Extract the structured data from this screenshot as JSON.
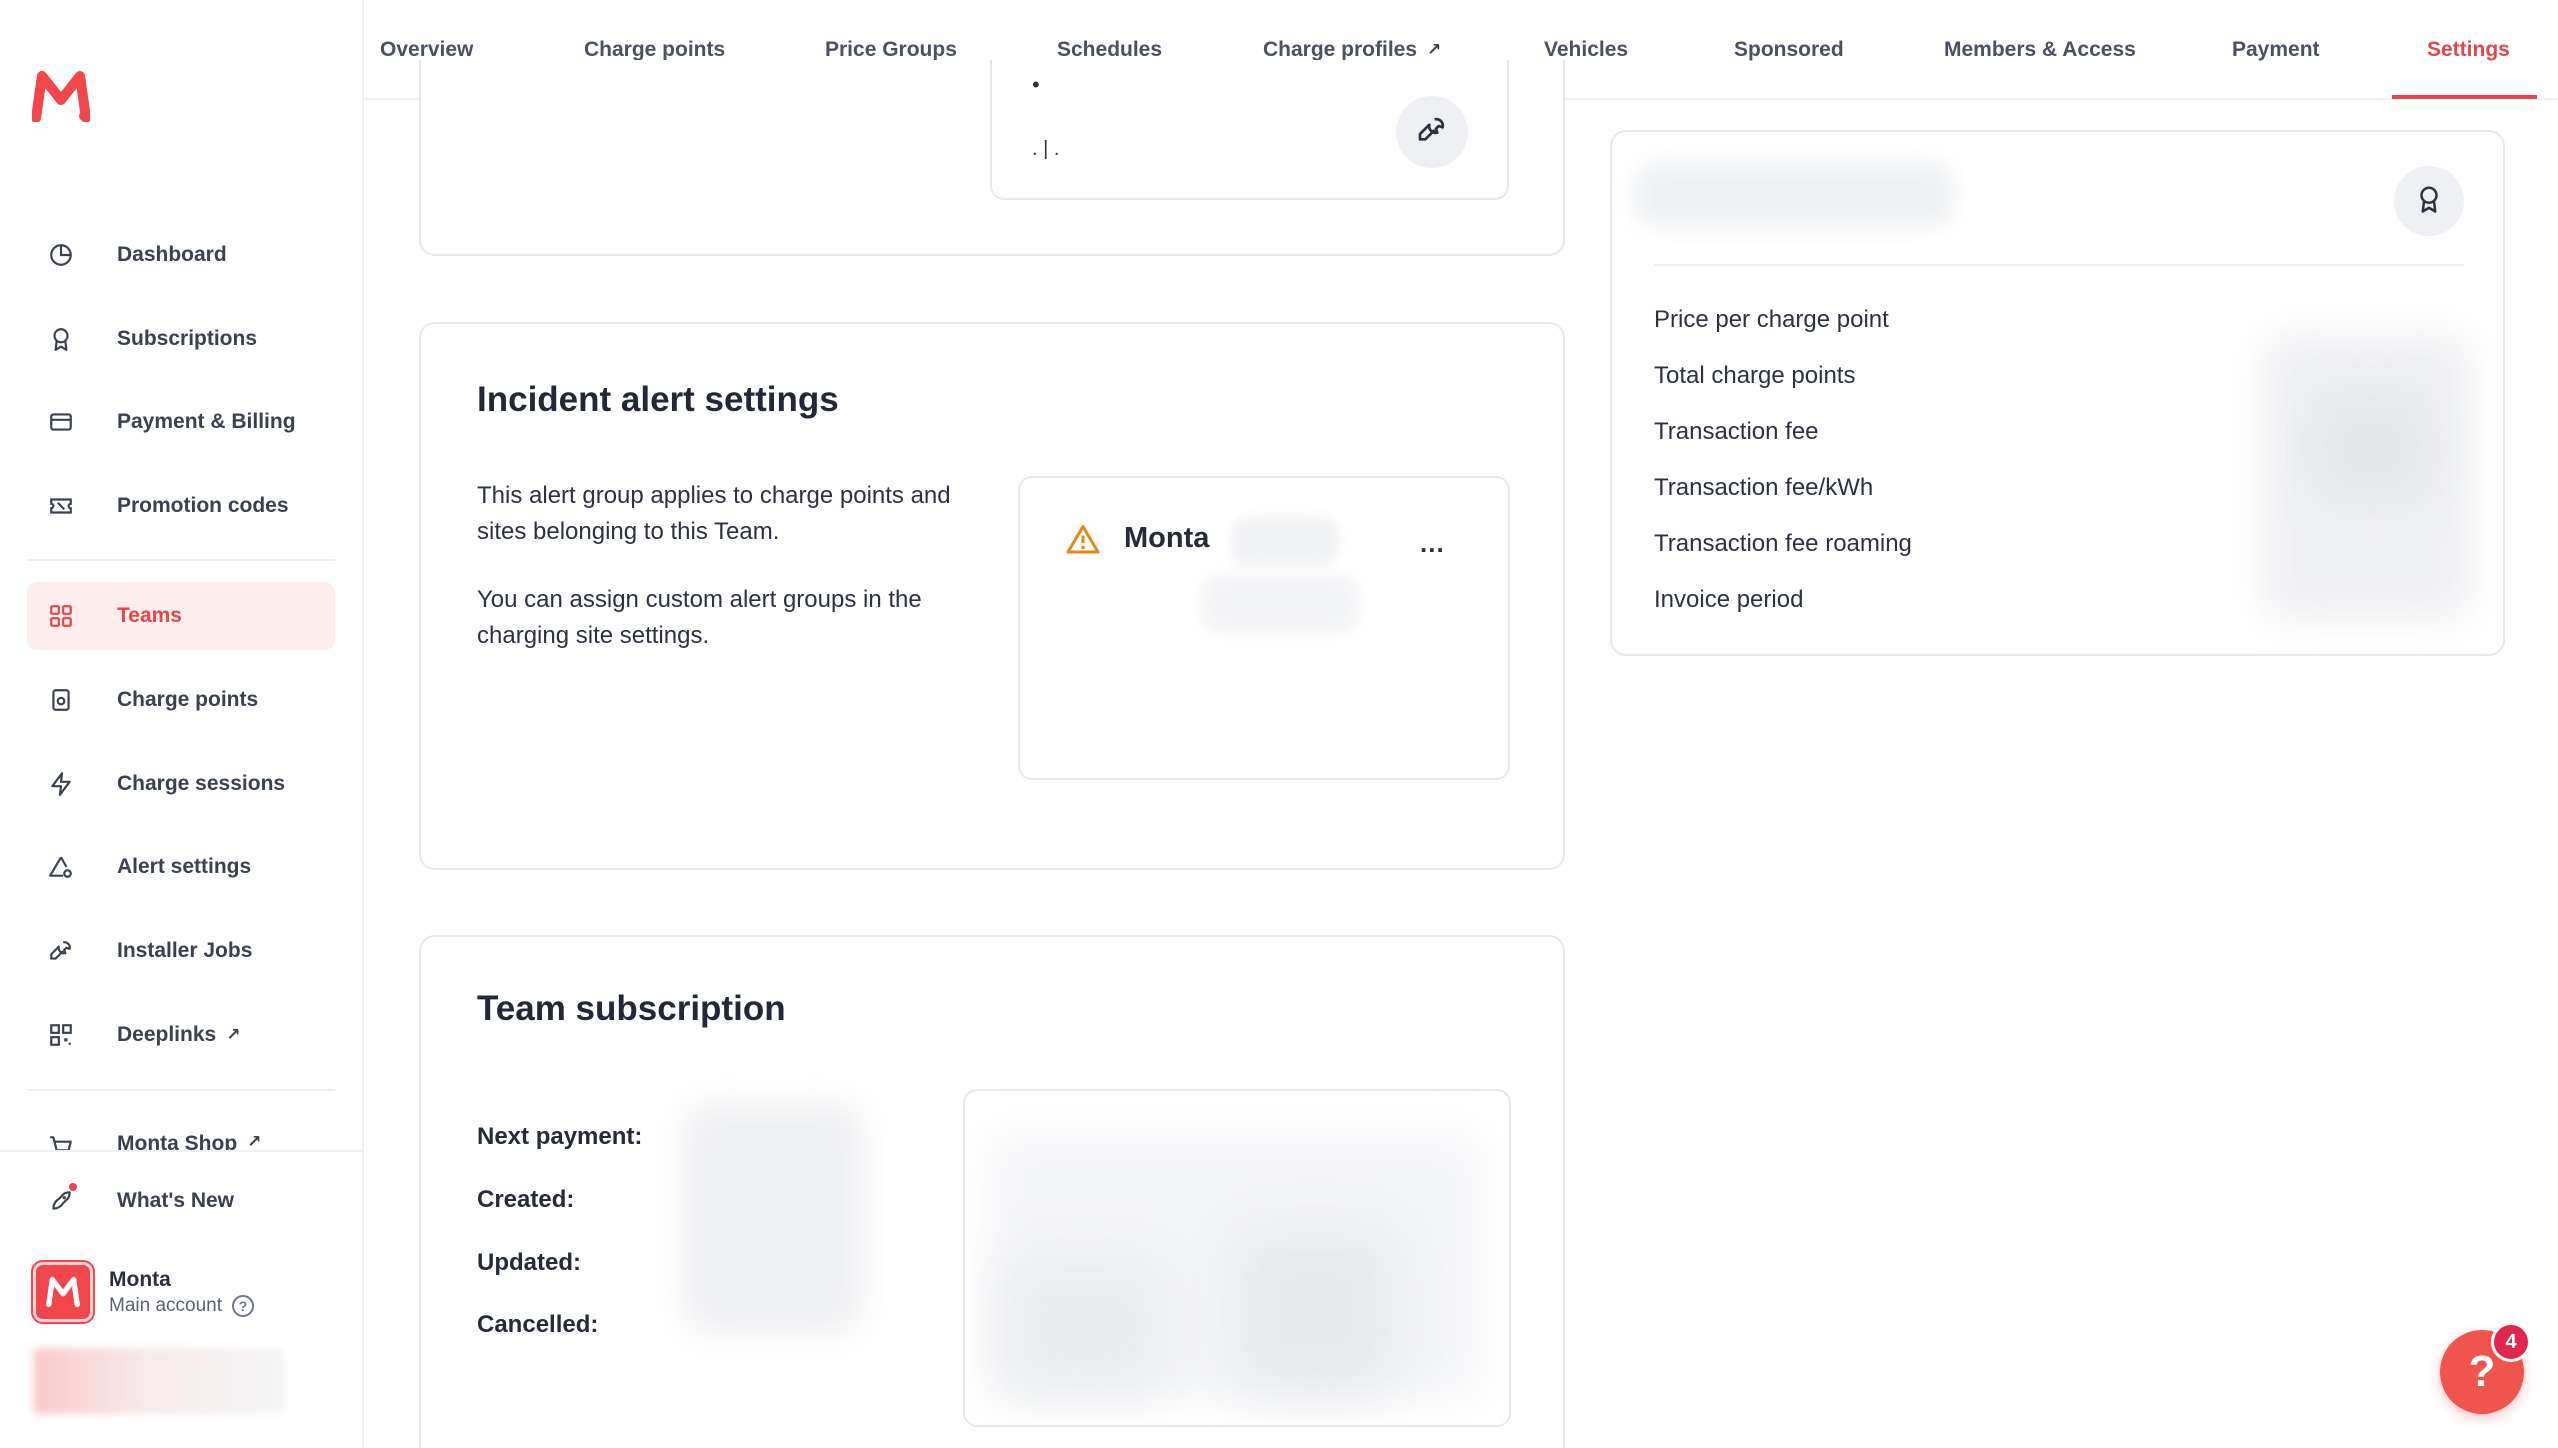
{
  "brand": {
    "logo_text": "M",
    "accent": "#e4464c"
  },
  "sidebar": {
    "items": [
      {
        "label": "Dashboard",
        "icon": "clock-pie-icon"
      },
      {
        "label": "Subscriptions",
        "icon": "award-icon"
      },
      {
        "label": "Payment & Billing",
        "icon": "card-icon"
      },
      {
        "label": "Promotion codes",
        "icon": "ticket-icon"
      },
      {
        "label": "Teams",
        "icon": "grid-icon",
        "active": true
      },
      {
        "label": "Charge points",
        "icon": "charger-icon"
      },
      {
        "label": "Charge sessions",
        "icon": "bolt-icon"
      },
      {
        "label": "Alert settings",
        "icon": "alert-gear-icon"
      },
      {
        "label": "Installer Jobs",
        "icon": "wrench-icon"
      },
      {
        "label": "Deeplinks",
        "icon": "qr-icon",
        "external": "↗"
      },
      {
        "label": "Monta Shop",
        "icon": "cart-icon",
        "external": "↗"
      }
    ],
    "whats_new": "What's New",
    "account": {
      "name": "Monta",
      "sub": "Main account",
      "help": "?"
    }
  },
  "tabs": [
    {
      "label": "Overview"
    },
    {
      "label": "Charge points"
    },
    {
      "label": "Price Groups"
    },
    {
      "label": "Schedules"
    },
    {
      "label": "Charge profiles",
      "external": "↗"
    },
    {
      "label": "Vehicles"
    },
    {
      "label": "Sponsored"
    },
    {
      "label": "Members & Access"
    },
    {
      "label": "Payment"
    },
    {
      "label": "Settings",
      "active": true
    }
  ],
  "top_card": {
    "glyph_1": "•",
    "glyph_2": ". | ."
  },
  "incident": {
    "title": "Incident alert settings",
    "desc_1": "This alert group applies to charge points and sites belonging to this Team.",
    "desc_2": "You can assign custom alert groups in the charging site settings.",
    "group_name": "Monta",
    "menu": "..."
  },
  "subscription": {
    "title": "Team subscription",
    "labels": [
      "Next payment:",
      "Created:",
      "Updated:",
      "Cancelled:"
    ]
  },
  "pricing": {
    "labels": [
      "Price per charge point",
      "Total charge points",
      "Transaction fee",
      "Transaction fee/kWh",
      "Transaction fee roaming",
      "Invoice period"
    ]
  },
  "help_fab": {
    "label": "?",
    "badge": "4"
  }
}
